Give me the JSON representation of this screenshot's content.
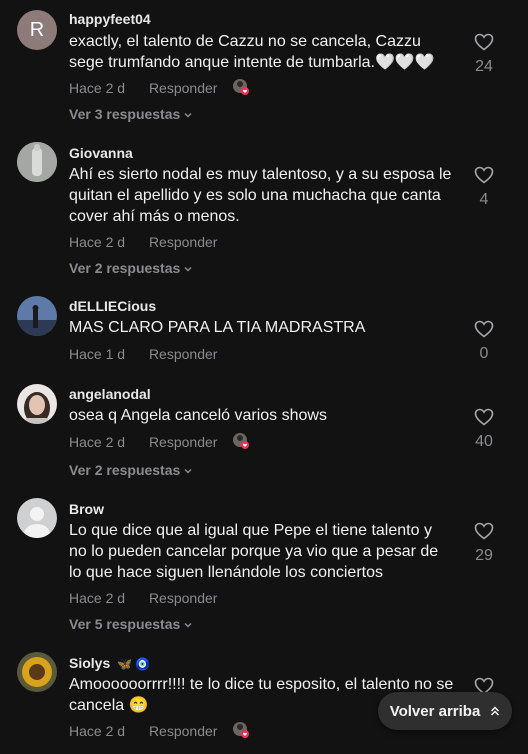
{
  "comments": [
    {
      "username": "happyfeet04",
      "avatar_letter": "R",
      "text": "exactly, el talento de Cazzu no se cancela, Cazzu sege trumfando anque intente de tumbarla.🤍🤍🤍",
      "time": "Hace 2 d",
      "reply_label": "Responder",
      "likes": "24",
      "replies": "Ver 3 respuestas"
    },
    {
      "username": "Giovanna",
      "text": "Ahí es sierto nodal es muy talentoso, y a su esposa le quitan el apellido y es solo una muchacha que canta cover ahí más o menos.",
      "time": "Hace 2 d",
      "reply_label": "Responder",
      "likes": "4",
      "replies": "Ver 2 respuestas"
    },
    {
      "username": "dELLIECious",
      "text": "MAS CLARO PARA LA TIA MADRASTRA",
      "time": "Hace 1 d",
      "reply_label": "Responder",
      "likes": "0"
    },
    {
      "username": "angelanodal",
      "text": "osea q Angela canceló varios shows",
      "time": "Hace 2 d",
      "reply_label": "Responder",
      "likes": "40",
      "replies": "Ver 2 respuestas"
    },
    {
      "username": "Brow",
      "text": "Lo que dice que al igual que Pepe el tiene talento y no lo pueden cancelar porque ya vio que a pesar de lo que hace siguen llenándole los conciertos",
      "time": "Hace 2 d",
      "reply_label": "Responder",
      "likes": "29",
      "replies": "Ver 5 respuestas"
    },
    {
      "username": "Siolys",
      "badges": "🦋 🧿",
      "text": "Amoooooorrrr!!!! te lo dice tu esposito, el talento no se cancela 😁",
      "time": "Hace 2 d",
      "reply_label": "Responder"
    }
  ],
  "back_to_top": "Volver arriba",
  "colors": {
    "background": "#121212",
    "muted": "#8a8b91",
    "text": "#f1f1f2",
    "creator_badge": "#fe2c55"
  }
}
